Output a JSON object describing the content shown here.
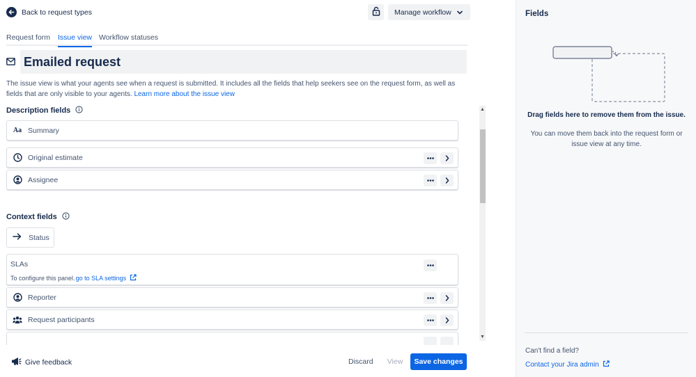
{
  "header": {
    "back_label": "Back to request types",
    "manage_workflow_label": "Manage workflow"
  },
  "tabs": [
    {
      "label": "Request form",
      "active": false
    },
    {
      "label": "Issue view",
      "active": true
    },
    {
      "label": "Workflow statuses",
      "active": false
    }
  ],
  "page": {
    "title": "Emailed request",
    "description": "The issue view is what your agents see when a request is submitted. It includes all the fields that help seekers see on the request form, as well as fields that are only visible to your agents.",
    "learn_more_link": "Learn more about the issue view"
  },
  "description_fields": {
    "heading": "Description fields",
    "items": [
      {
        "label": "Summary",
        "icon": "text-format-icon"
      },
      {
        "label": "Original estimate",
        "icon": "clock-icon"
      },
      {
        "label": "Assignee",
        "icon": "person-circle-icon"
      }
    ]
  },
  "context_fields": {
    "heading": "Context fields",
    "status_label": "Status",
    "sla_title": "SLAs",
    "sla_hint": "To configure this panel.",
    "sla_link": "go to SLA settings",
    "items": [
      {
        "label": "Reporter",
        "icon": "person-circle-icon"
      },
      {
        "label": "Request participants",
        "icon": "people-group-icon"
      }
    ]
  },
  "footer": {
    "feedback_label": "Give feedback",
    "discard_label": "Discard",
    "view_label": "View",
    "save_label": "Save changes"
  },
  "right_panel": {
    "title": "Fields",
    "drop_heading": "Drag fields here to remove them from the issue.",
    "drop_text": "You can move them back into the request form or issue view at any time.",
    "cant_find": "Can't find a field?",
    "contact_link": "Contact your Jira admin"
  },
  "colors": {
    "brand_blue": "#0c66e4",
    "text_dark": "#172b4d",
    "text_subtle": "#44546f",
    "panel_bg": "#f7f8f9"
  }
}
